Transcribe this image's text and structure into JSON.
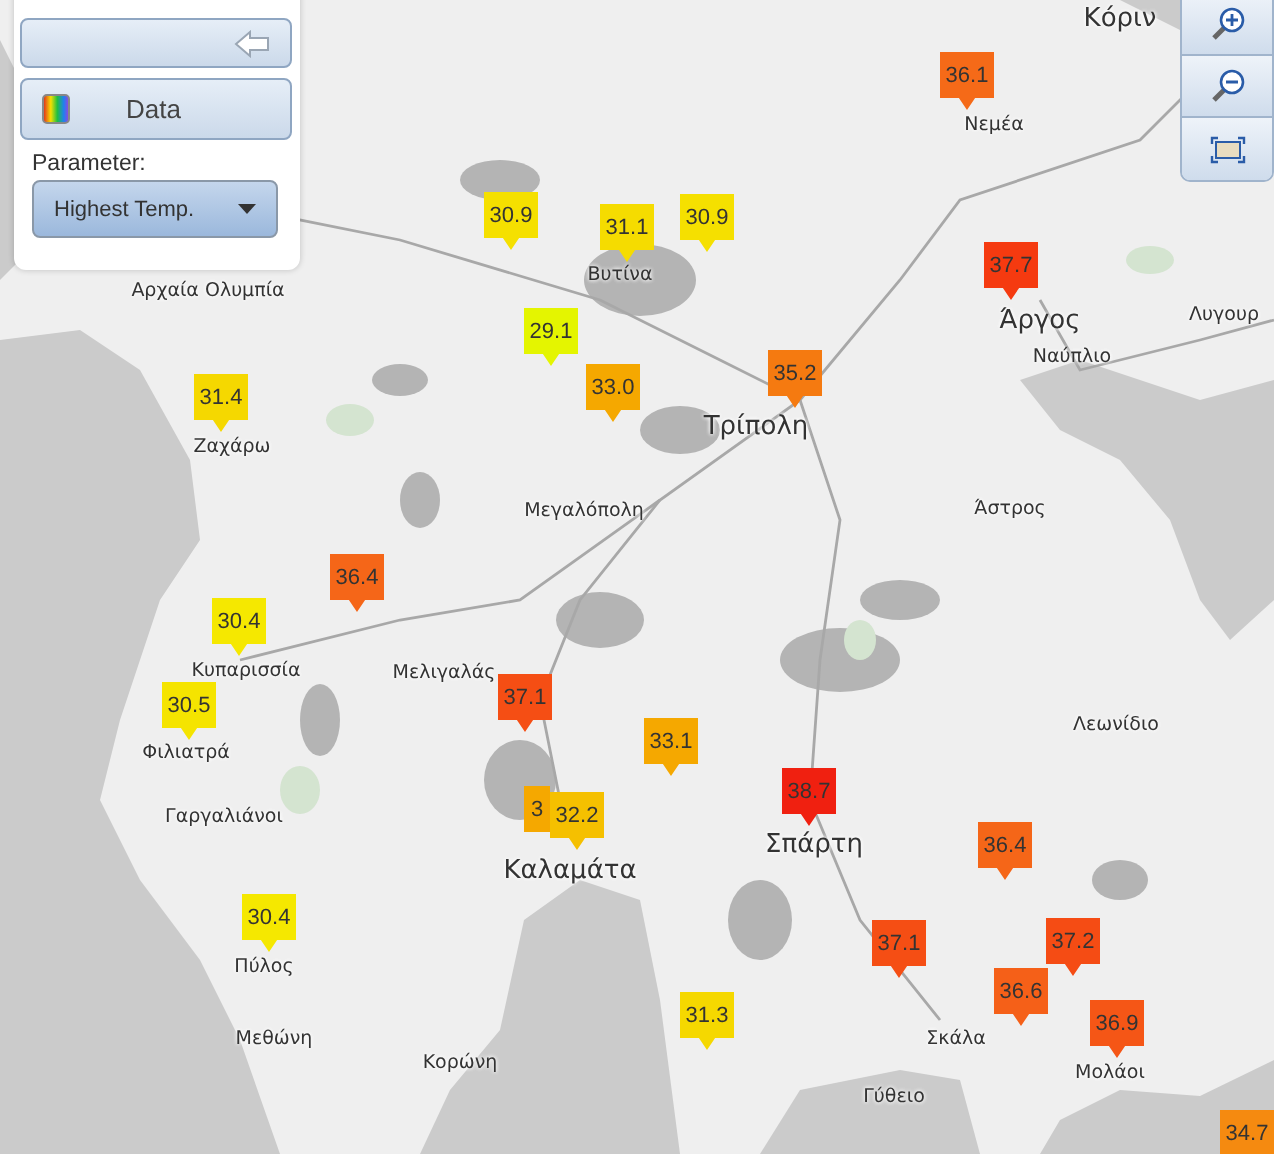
{
  "panel": {
    "data_tab": "Data",
    "parameter_label": "Parameter:",
    "parameter_select": {
      "value": "Highest Temp."
    }
  },
  "map_controls": [
    {
      "kind": "zoom-in"
    },
    {
      "kind": "zoom-out"
    },
    {
      "kind": "extent"
    }
  ],
  "places": [
    {
      "name": "Κόριν",
      "kind": "town"
    },
    {
      "name": "Νεμέα",
      "kind": "village"
    },
    {
      "name": "Άργος",
      "kind": "town"
    },
    {
      "name": "Λυγουρ",
      "kind": "village"
    },
    {
      "name": "Ναύπλιο",
      "kind": "village"
    },
    {
      "name": "Τρίπολη",
      "kind": "town"
    },
    {
      "name": "Άστρος",
      "kind": "village"
    },
    {
      "name": "Μεγαλόπολη",
      "kind": "village"
    },
    {
      "name": "Ζαχάρω",
      "kind": "village"
    },
    {
      "name": "Βυτίνα",
      "kind": "village"
    },
    {
      "name": "Αρχαία Ολυμπία",
      "kind": "village"
    },
    {
      "name": "Κυπαρισσία",
      "kind": "village"
    },
    {
      "name": "Φιλιατρά",
      "kind": "village"
    },
    {
      "name": "Μελιγαλάς",
      "kind": "village"
    },
    {
      "name": "Γαργαλιάνοι",
      "kind": "village"
    },
    {
      "name": "Καλαμάτα",
      "kind": "town"
    },
    {
      "name": "Σπάρτη",
      "kind": "town"
    },
    {
      "name": "Λεωνίδιο",
      "kind": "village"
    },
    {
      "name": "Πύλος",
      "kind": "village"
    },
    {
      "name": "Μεθώνη",
      "kind": "village"
    },
    {
      "name": "Κορώνη",
      "kind": "village"
    },
    {
      "name": "Γύθειο",
      "kind": "village"
    },
    {
      "name": "Σκάλα",
      "kind": "village"
    },
    {
      "name": "Μολάοι",
      "kind": "village"
    }
  ],
  "markers": [
    {
      "value": "30.9",
      "color": "#f5e000",
      "covered": false
    },
    {
      "value": "31.1",
      "color": "#f5dc00",
      "covered": false
    },
    {
      "value": "30.9",
      "color": "#f5e000",
      "covered": false
    },
    {
      "value": "29.1",
      "color": "#e4f500",
      "covered": false
    },
    {
      "value": "33.0",
      "color": "#f5a800",
      "covered": false
    },
    {
      "value": "35.2",
      "color": "#f57a10",
      "covered": false
    },
    {
      "value": "36.1",
      "color": "#f56a18",
      "covered": false
    },
    {
      "value": "37.7",
      "color": "#f53a10",
      "covered": false
    },
    {
      "value": "31.4",
      "color": "#f5d800",
      "covered": false
    },
    {
      "value": "36.4",
      "color": "#f56618",
      "covered": false
    },
    {
      "value": "30.4",
      "color": "#f5e800",
      "covered": false
    },
    {
      "value": "30.5",
      "color": "#f5e400",
      "covered": false
    },
    {
      "value": "37.1",
      "color": "#f54e14",
      "covered": false
    },
    {
      "value": "33.1",
      "color": "#f5a800",
      "covered": false
    },
    {
      "value": "3",
      "color": "#f5a800",
      "covered": true
    },
    {
      "value": "32.2",
      "color": "#f5c000",
      "covered": false
    },
    {
      "value": "30.4",
      "color": "#f5e800",
      "covered": false
    },
    {
      "value": "38.7",
      "color": "#f02010",
      "covered": false
    },
    {
      "value": "36.4",
      "color": "#f56618",
      "covered": false
    },
    {
      "value": "37.1",
      "color": "#f54e14",
      "covered": false
    },
    {
      "value": "37.2",
      "color": "#f54c14",
      "covered": false
    },
    {
      "value": "36.6",
      "color": "#f56018",
      "covered": false
    },
    {
      "value": "36.9",
      "color": "#f55616",
      "covered": false
    },
    {
      "value": "31.3",
      "color": "#f5d800",
      "covered": false
    },
    {
      "value": "34.7",
      "color": "#f58a10",
      "covered": false
    }
  ]
}
